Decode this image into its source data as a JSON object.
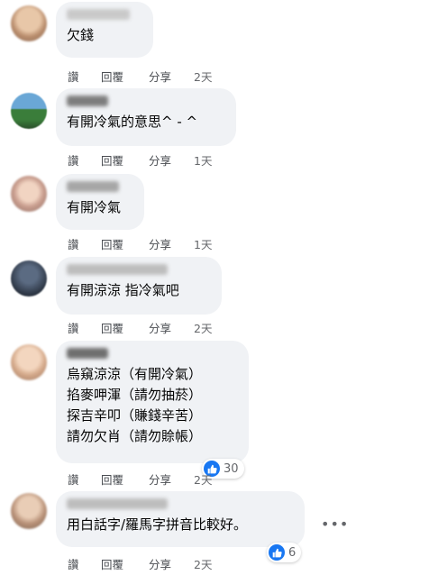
{
  "actions": {
    "like": "讚",
    "reply": "回覆",
    "share": "分享"
  },
  "comments": [
    {
      "lines": [
        "欠錢"
      ],
      "time": "2天"
    },
    {
      "lines": [
        "有開冷氣的意思^ - ^"
      ],
      "time": "1天"
    },
    {
      "lines": [
        "有開冷氣"
      ],
      "time": "1天"
    },
    {
      "lines": [
        "有開涼涼 指冷氣吧"
      ],
      "time": "2天"
    },
    {
      "lines": [
        "烏窺涼涼（有開冷氣）",
        "掐麥呷渾（請勿抽菸）",
        "探吉辛叩（賺錢辛苦）",
        "請勿欠肖（請勿賒帳）"
      ],
      "time": "2天",
      "reactions": "30"
    },
    {
      "lines": [
        "用白話字/羅馬字拼音比較好。"
      ],
      "time": "2天",
      "reactions": "6"
    }
  ],
  "more_icon": "ellipsis-icon",
  "reaction_icon": "thumbs-up-icon",
  "colors": {
    "bubble": "#f0f2f5",
    "like_blue": "#1877f2",
    "meta": "#65676b"
  }
}
